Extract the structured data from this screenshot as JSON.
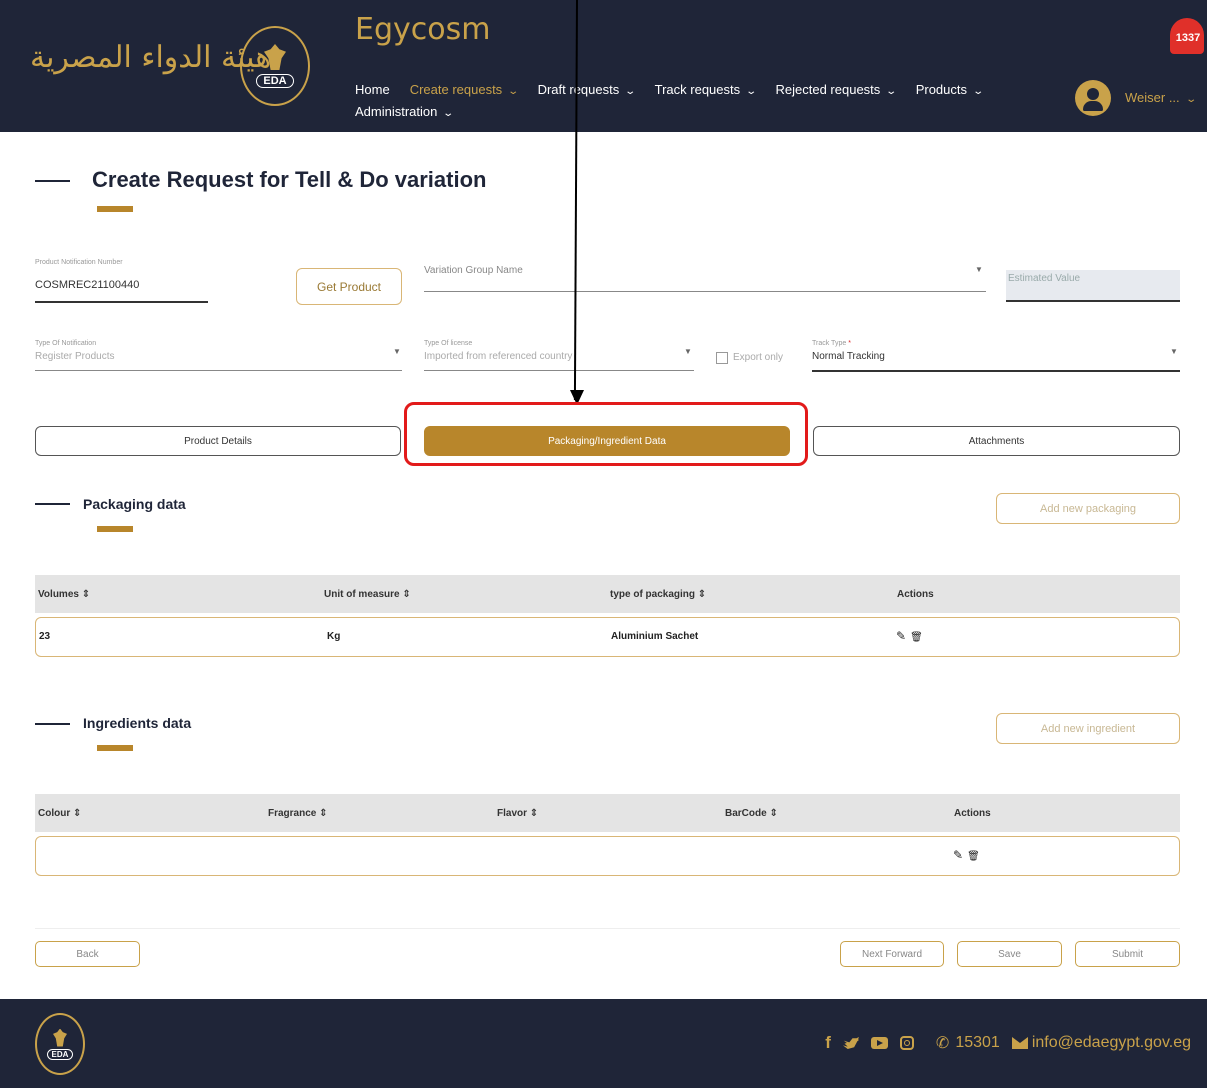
{
  "header": {
    "arabic_logo": "هيئة الدواء المصرية",
    "seal_text": "EDA",
    "brand": "Egycosm",
    "nav": [
      {
        "label": "Home"
      },
      {
        "label": "Create requests"
      },
      {
        "label": "Draft requests"
      },
      {
        "label": "Track requests"
      },
      {
        "label": "Rejected requests"
      },
      {
        "label": "Products"
      },
      {
        "label": "Administration"
      }
    ],
    "notification_count": "1337",
    "user_name": "Weiser ...",
    "chevron": "⌄"
  },
  "page": {
    "title": "Create Request for Tell & Do variation"
  },
  "form": {
    "product_notification_label": "Product Notification Number",
    "product_notification_value": "COSMREC21100440",
    "get_product_label": "Get Product",
    "variation_group_placeholder": "Variation Group Name",
    "estimated_value_placeholder": "Estimated Value",
    "type_of_notification_label": "Type Of Notification",
    "type_of_notification_value": "Register Products",
    "type_of_license_label": "Type Of license",
    "type_of_license_value": "Imported from referenced country",
    "export_only_label": "Export only",
    "track_type_label": "Track Type",
    "track_type_value": "Normal Tracking"
  },
  "tabs": [
    {
      "label": "Product Details"
    },
    {
      "label": "Packaging/Ingredient Data"
    },
    {
      "label": "Attachments"
    }
  ],
  "packaging": {
    "title": "Packaging data",
    "add_label": "Add new packaging",
    "columns": [
      "Volumes ⇕",
      "Unit of measure ⇕",
      "type of packaging ⇕",
      "Actions"
    ],
    "rows": [
      {
        "volume": "23",
        "unit": "Kg",
        "type": "Aluminium Sachet"
      }
    ]
  },
  "ingredients": {
    "title": "Ingredients data",
    "add_label": "Add new ingredient",
    "columns": [
      "Colour ⇕",
      "Fragrance ⇕",
      "Flavor ⇕",
      "BarCode ⇕",
      "Actions"
    ]
  },
  "actions": {
    "edit_icon": "✎",
    "delete_icon": "🗑"
  },
  "buttons": {
    "back": "Back",
    "next_forward": "Next Forward",
    "save": "Save",
    "submit": "Submit"
  },
  "footer": {
    "seal_text": "EDA",
    "phone": "15301",
    "email": "info@edaegypt.gov.eg"
  },
  "colors": {
    "navy": "#1f2538",
    "gold": "#b8862b",
    "highlight": "#e21a1a"
  }
}
